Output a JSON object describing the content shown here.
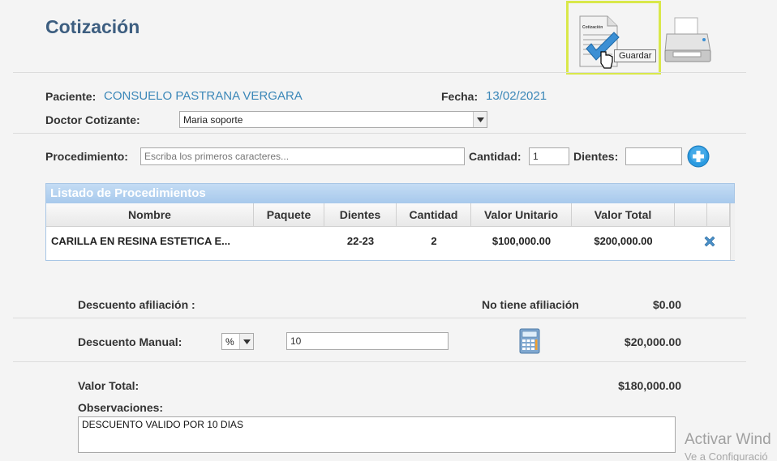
{
  "page": {
    "title": "Cotización"
  },
  "toolbar": {
    "save_tooltip": "Guardar",
    "doc_label": "Cotización"
  },
  "patient": {
    "label": "Paciente:",
    "value": "CONSUELO PASTRANA VERGARA"
  },
  "date": {
    "label": "Fecha:",
    "value": "13/02/2021"
  },
  "doctor": {
    "label": "Doctor Cotizante:",
    "value": "Maria soporte"
  },
  "procedure": {
    "label": "Procedimiento:",
    "placeholder": "Escriba los primeros caracteres...",
    "qty_label": "Cantidad:",
    "qty_value": "1",
    "teeth_label": "Dientes:",
    "teeth_value": ""
  },
  "grid": {
    "caption": "Listado de Procedimientos",
    "columns": [
      "Nombre",
      "Paquete",
      "Dientes",
      "Cantidad",
      "Valor Unitario",
      "Valor Total"
    ],
    "rows": [
      {
        "nombre": "CARILLA EN RESINA ESTETICA E...",
        "paquete": "",
        "dientes": "22-23",
        "cantidad": "2",
        "valor_unitario": "$100,000.00",
        "valor_total": "$200,000.00"
      }
    ]
  },
  "discount_affiliation": {
    "label": "Descuento afiliación :",
    "status": "No tiene afiliación",
    "amount": "$0.00"
  },
  "discount_manual": {
    "label": "Descuento Manual:",
    "type_value": "%",
    "input_value": "10",
    "amount": "$20,000.00"
  },
  "total": {
    "label": "Valor Total:",
    "amount": "$180,000.00"
  },
  "observations": {
    "label": "Observaciones:",
    "value": "DESCUENTO VALIDO POR 10 DIAS"
  },
  "watermark": {
    "line1": "Activar Wind",
    "line2": "Ve a Configuració"
  },
  "colors": {
    "accent": "#3d5e80",
    "link": "#3b87b8",
    "highlight": "#d9e84a",
    "grid_header": "#a7c9ec"
  }
}
